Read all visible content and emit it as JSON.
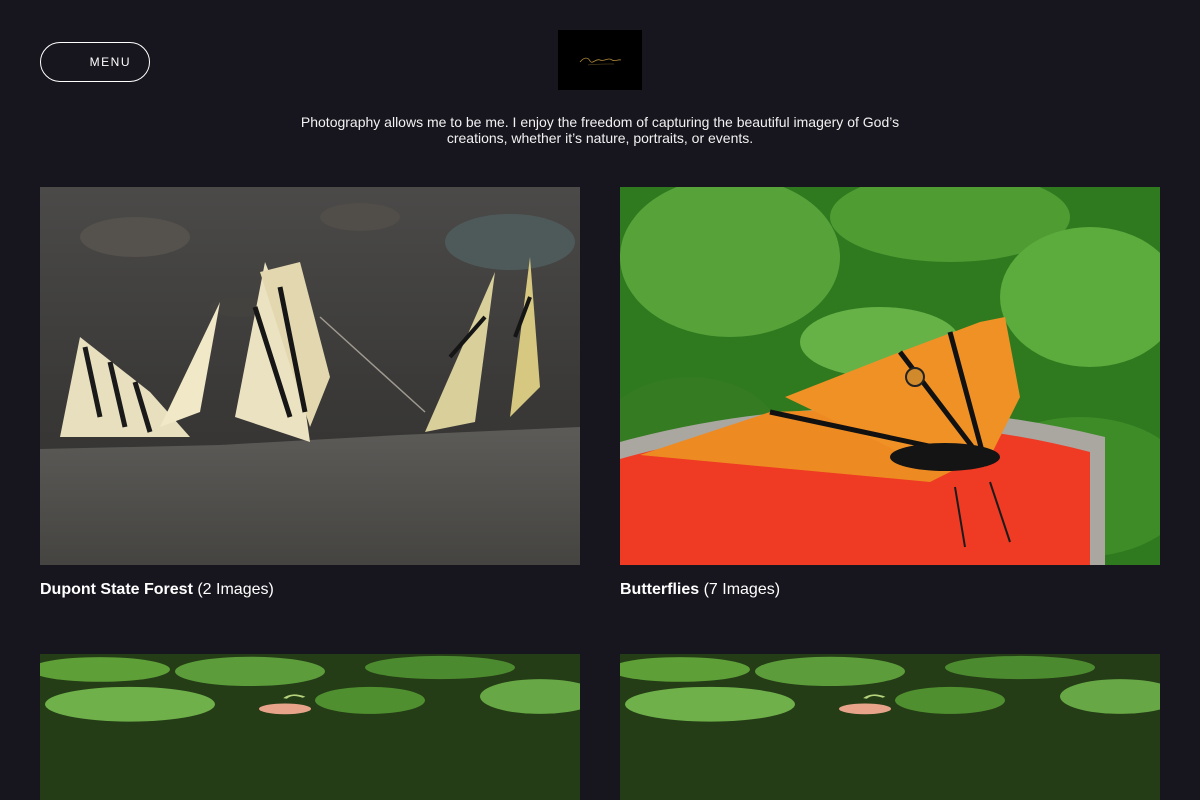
{
  "header": {
    "menu_label": "MENU",
    "logo_text": "Lourdes Johnson",
    "tagline": "Photography allows me to be me. I enjoy the freedom of capturing the beautiful imagery of God’s creations, whether it’s nature, portraits, or events."
  },
  "gallery": {
    "items": [
      {
        "title": "Dupont State Forest",
        "count": "(2 Images)"
      },
      {
        "title": "Butterflies",
        "count": "(7 Images)"
      }
    ]
  },
  "colors": {
    "background": "#17161e",
    "text": "#ffffff"
  }
}
